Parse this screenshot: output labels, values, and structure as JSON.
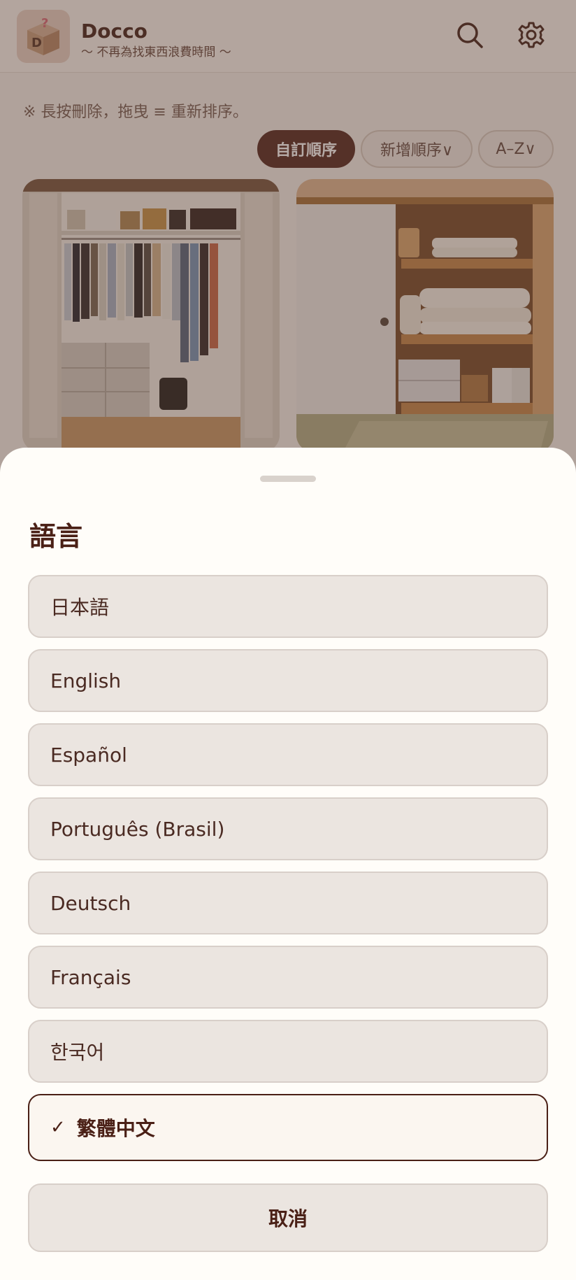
{
  "app": {
    "title": "Docco",
    "subtitle": "〜 不再為找東西浪費時間 〜",
    "logo_letter": "D",
    "logo_mark": "?"
  },
  "header": {
    "search_icon": "search-icon",
    "settings_icon": "gear-icon"
  },
  "main": {
    "hint": "※ 長按刪除，拖曳 ≡ 重新排序。",
    "sort_chips": [
      {
        "label": "自訂順序",
        "active": true
      },
      {
        "label": "新增順序∨",
        "active": false
      },
      {
        "label": "A–Z∨",
        "active": false
      }
    ]
  },
  "sheet": {
    "title": "語言",
    "options": [
      {
        "label": "日本語",
        "selected": false
      },
      {
        "label": "English",
        "selected": false
      },
      {
        "label": "Español",
        "selected": false
      },
      {
        "label": "Português (Brasil)",
        "selected": false
      },
      {
        "label": "Deutsch",
        "selected": false
      },
      {
        "label": "Français",
        "selected": false
      },
      {
        "label": "한국어",
        "selected": false
      },
      {
        "label": "繁體中文",
        "selected": true
      }
    ],
    "check_mark": "✓",
    "cancel_label": "取消"
  },
  "colors": {
    "accent": "#5a2f26",
    "sheet_bg": "#fffdf9",
    "option_bg": "#ebe5e0"
  }
}
